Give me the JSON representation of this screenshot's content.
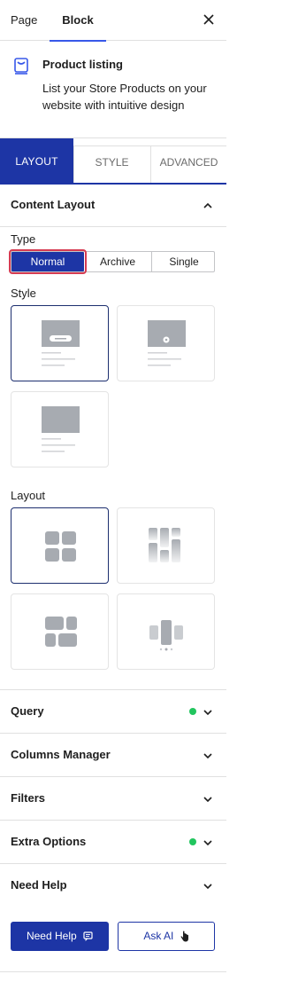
{
  "top_tabs": {
    "page": "Page",
    "block": "Block"
  },
  "block_card": {
    "title": "Product listing",
    "description": "List your Store Products on your website with intuitive design"
  },
  "main_tabs": {
    "layout": "LAYOUT",
    "style": "STYLE",
    "advanced": "ADVANCED"
  },
  "content_layout": {
    "title": "Content Layout",
    "type_label": "Type",
    "type_options": [
      "Normal",
      "Archive",
      "Single"
    ],
    "type_selected": "Normal",
    "style_label": "Style",
    "layout_label": "Layout"
  },
  "sections": [
    {
      "title": "Query",
      "has_dot": true
    },
    {
      "title": "Columns Manager",
      "has_dot": false
    },
    {
      "title": "Filters",
      "has_dot": false
    },
    {
      "title": "Extra Options",
      "has_dot": true
    },
    {
      "title": "Need Help",
      "has_dot": false
    }
  ],
  "buttons": {
    "need_help": "Need Help",
    "ask_ai": "Ask AI"
  },
  "colors": {
    "accent": "#1d35a5",
    "selection_outline": "#d63b52",
    "status_dot": "#22c55e"
  }
}
